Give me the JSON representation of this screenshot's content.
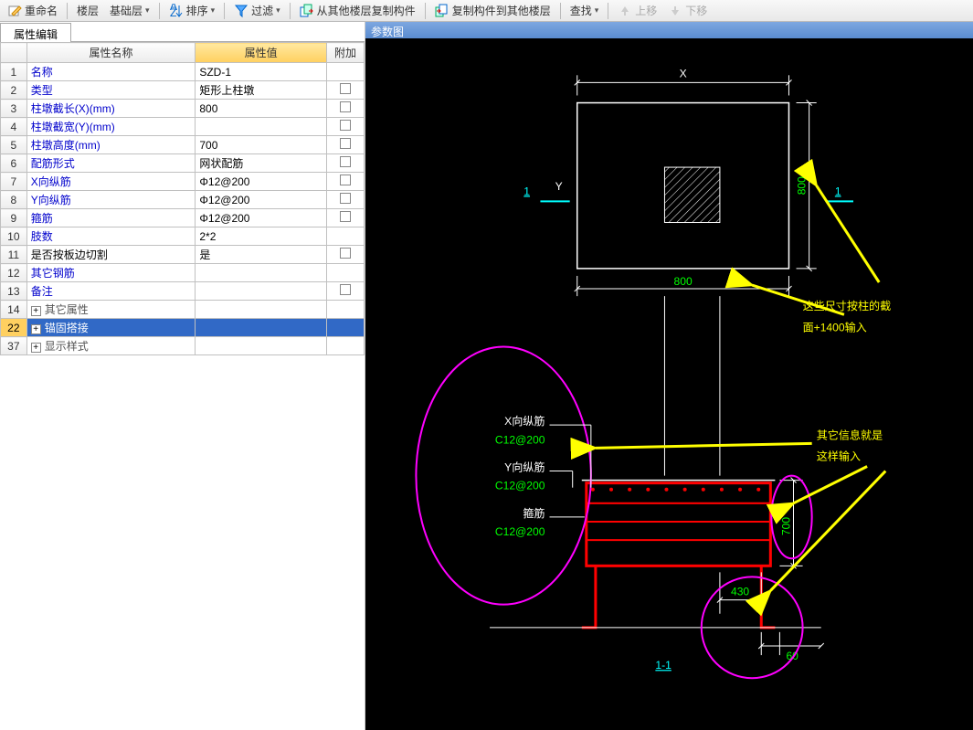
{
  "toolbar": {
    "rename": "重命名",
    "floor": "楼层",
    "baseLayer": "基础层",
    "sort": "排序",
    "filter": "过滤",
    "copyFrom": "从其他楼层复制构件",
    "copyTo": "复制构件到其他楼层",
    "find": "查找",
    "moveUp": "上移",
    "moveDown": "下移"
  },
  "leftPanel": {
    "tab": "属性编辑",
    "headers": {
      "name": "属性名称",
      "value": "属性值",
      "add": "附加"
    },
    "rows": [
      {
        "n": "1",
        "name": "名称",
        "value": "SZD-1",
        "add": false,
        "blue": true
      },
      {
        "n": "2",
        "name": "类型",
        "value": "矩形上柱墩",
        "add": true,
        "blue": true
      },
      {
        "n": "3",
        "name": "柱墩截长(X)(mm)",
        "value": "800",
        "add": true,
        "blue": true
      },
      {
        "n": "4",
        "name": "柱墩截宽(Y)(mm)",
        "value": "",
        "add": true,
        "blue": true
      },
      {
        "n": "5",
        "name": "柱墩高度(mm)",
        "value": "700",
        "add": true,
        "blue": true
      },
      {
        "n": "6",
        "name": "配筋形式",
        "value": "网状配筋",
        "add": true,
        "blue": true
      },
      {
        "n": "7",
        "name": "X向纵筋",
        "value": "Φ12@200",
        "add": true,
        "blue": true
      },
      {
        "n": "8",
        "name": "Y向纵筋",
        "value": "Φ12@200",
        "add": true,
        "blue": true
      },
      {
        "n": "9",
        "name": "箍筋",
        "value": "Φ12@200",
        "add": true,
        "blue": true
      },
      {
        "n": "10",
        "name": "肢数",
        "value": "2*2",
        "add": false,
        "blue": true
      },
      {
        "n": "11",
        "name": "是否按板边切割",
        "value": "是",
        "add": true,
        "blue": false
      },
      {
        "n": "12",
        "name": "其它钢筋",
        "value": "",
        "add": false,
        "blue": true
      },
      {
        "n": "13",
        "name": "备注",
        "value": "",
        "add": true,
        "blue": true
      }
    ],
    "groups": [
      {
        "n": "14",
        "name": "其它属性",
        "selected": false
      },
      {
        "n": "22",
        "name": "锚固搭接",
        "selected": true
      },
      {
        "n": "37",
        "name": "显示样式",
        "selected": false
      }
    ]
  },
  "rightPanel": {
    "title": "参数图",
    "topView": {
      "xLabel": "X",
      "yLabel": "Y",
      "leftSec": "1",
      "rightSec": "1",
      "width": "800",
      "height": "800"
    },
    "annot1_line1": "这些尺寸按柱的截",
    "annot1_line2": "面+1400输入",
    "sideView": {
      "label_x": "X向纵筋",
      "val_x": "C12@200",
      "label_y": "Y向纵筋",
      "val_y": "C12@200",
      "label_g": "箍筋",
      "val_g": "C12@200",
      "h": "700",
      "d1": "430",
      "d2": "60",
      "section": "1-1"
    },
    "annot2_line1": "其它信息就是",
    "annot2_line2": "这样输入"
  }
}
